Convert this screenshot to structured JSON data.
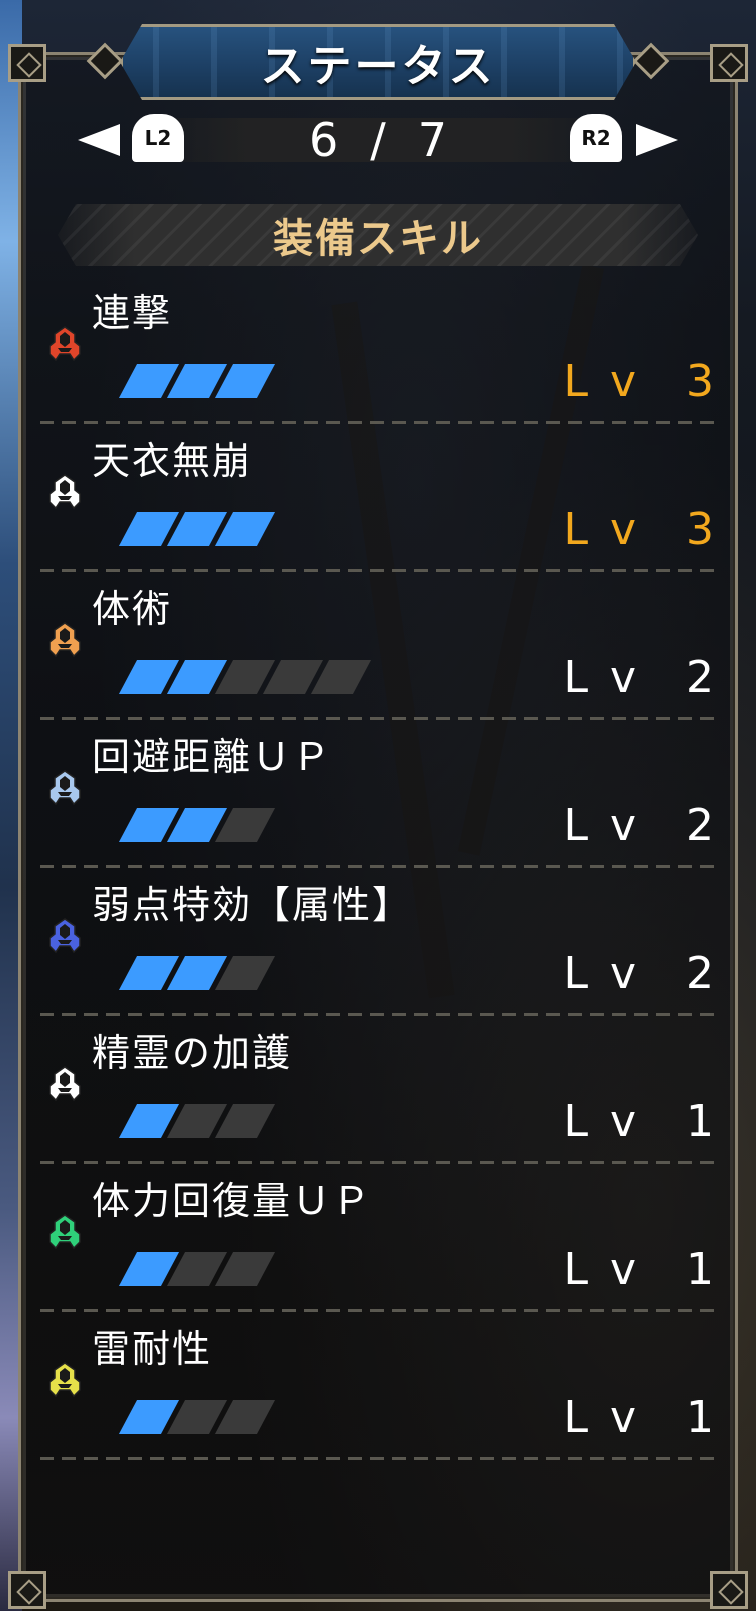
{
  "header": {
    "title": "ステータス",
    "page_current": "6",
    "page_separator": "/",
    "page_total": "7",
    "prev_button": "L2",
    "next_button": "R2"
  },
  "section": {
    "title": "装備スキル"
  },
  "colors": {
    "bar_filled": "#3c9bff",
    "bar_empty": "#3a3a3a",
    "level_max": "#f2a81e",
    "level_normal": "#ffffff",
    "section_title": "#ecc98c"
  },
  "skills": [
    {
      "name": "連撃",
      "level_prefix": "Lv",
      "level": "3",
      "filled": 3,
      "max": 3,
      "maxed": true,
      "icon_color": "#e0452a",
      "icon": "skill-gem-icon"
    },
    {
      "name": "天衣無崩",
      "level_prefix": "Lv",
      "level": "3",
      "filled": 3,
      "max": 3,
      "maxed": true,
      "icon_color": "#ffffff",
      "icon": "skill-gem-icon"
    },
    {
      "name": "体術",
      "level_prefix": "Lv",
      "level": "2",
      "filled": 2,
      "max": 5,
      "maxed": false,
      "icon_color": "#f0a050",
      "icon": "skill-gem-icon"
    },
    {
      "name": "回避距離ＵＰ",
      "level_prefix": "Lv",
      "level": "2",
      "filled": 2,
      "max": 3,
      "maxed": false,
      "icon_color": "#a8c8ee",
      "icon": "skill-gem-icon"
    },
    {
      "name": "弱点特効【属性】",
      "level_prefix": "Lv",
      "level": "2",
      "filled": 2,
      "max": 3,
      "maxed": false,
      "icon_color": "#4a62e0",
      "icon": "skill-gem-icon"
    },
    {
      "name": "精霊の加護",
      "level_prefix": "Lv",
      "level": "1",
      "filled": 1,
      "max": 3,
      "maxed": false,
      "icon_color": "#ffffff",
      "icon": "skill-gem-icon"
    },
    {
      "name": "体力回復量ＵＰ",
      "level_prefix": "Lv",
      "level": "1",
      "filled": 1,
      "max": 3,
      "maxed": false,
      "icon_color": "#2fd07a",
      "icon": "skill-gem-icon"
    },
    {
      "name": "雷耐性",
      "level_prefix": "Lv",
      "level": "1",
      "filled": 1,
      "max": 3,
      "maxed": false,
      "icon_color": "#e6e04a",
      "icon": "skill-gem-icon"
    }
  ]
}
